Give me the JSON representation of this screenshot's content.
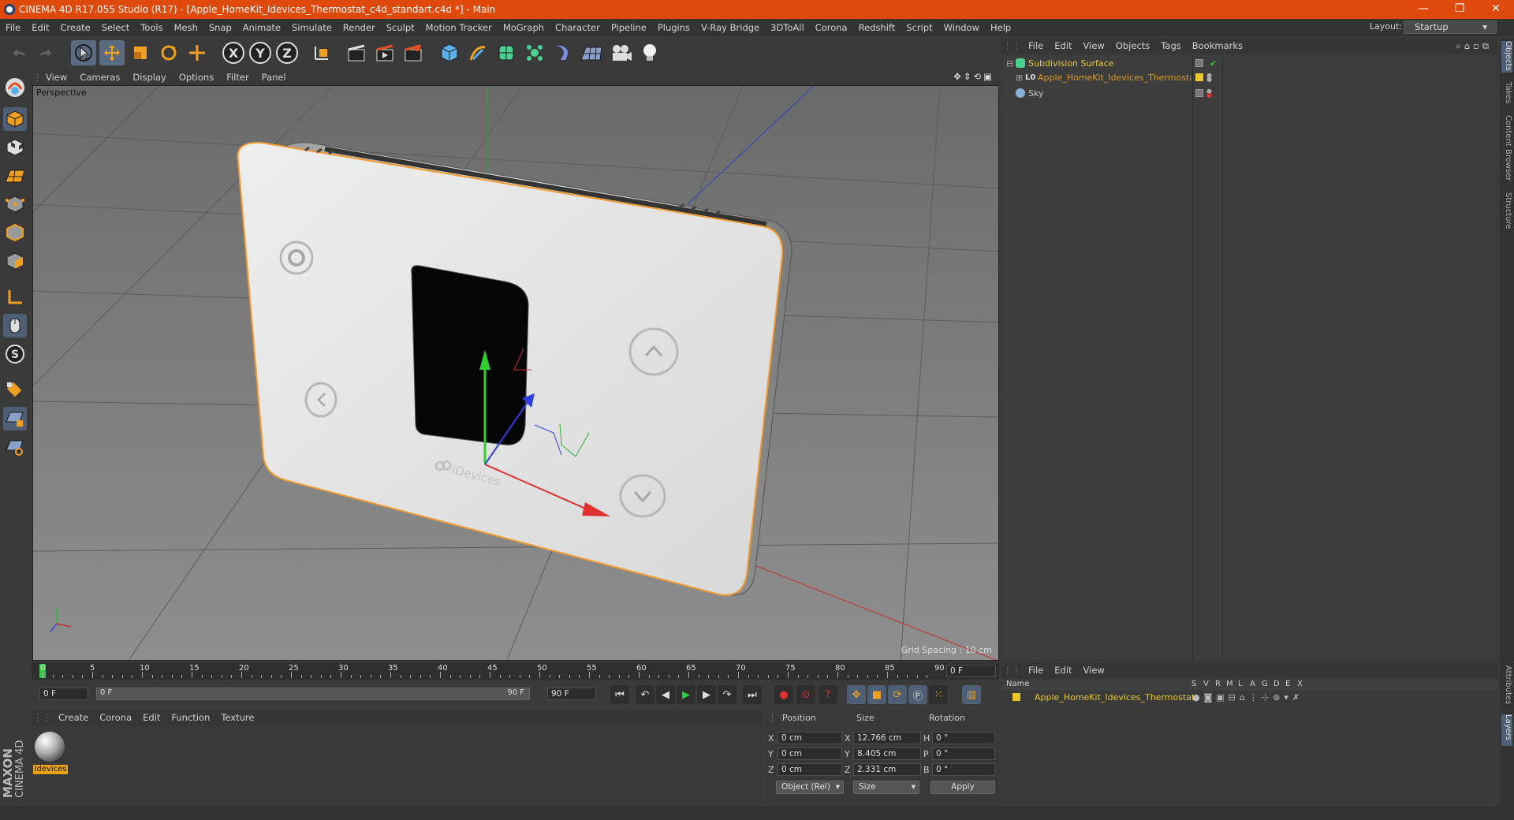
{
  "window": {
    "title": "CINEMA 4D R17.055 Studio (R17) - [Apple_HomeKit_Idevices_Thermostat_c4d_standart.c4d *] - Main",
    "minimize": "—",
    "restore": "❐",
    "close": "✕"
  },
  "menu": [
    "File",
    "Edit",
    "Create",
    "Select",
    "Tools",
    "Mesh",
    "Snap",
    "Animate",
    "Simulate",
    "Render",
    "Sculpt",
    "Motion Tracker",
    "MoGraph",
    "Character",
    "Pipeline",
    "Plugins",
    "V-Ray Bridge",
    "3DToAll",
    "Corona",
    "Redshift",
    "Script",
    "Window",
    "Help"
  ],
  "layout": {
    "label": "Layout:",
    "value": "Startup"
  },
  "axis_buttons": [
    "X",
    "Y",
    "Z"
  ],
  "viewport": {
    "menu": [
      "View",
      "Cameras",
      "Display",
      "Options",
      "Filter",
      "Panel"
    ],
    "camera_label": "Perspective",
    "grid_spacing": "Grid Spacing : 10 cm",
    "device_brand": "iDevices",
    "axis_colors": {
      "x": "#e03030",
      "y": "#30d030",
      "z": "#3040e0"
    }
  },
  "timeline": {
    "ticks": [
      "0",
      "5",
      "10",
      "15",
      "20",
      "25",
      "30",
      "35",
      "40",
      "45",
      "50",
      "55",
      "60",
      "65",
      "70",
      "75",
      "80",
      "85",
      "90"
    ],
    "current_frame_right": "0 F",
    "start_field": "0 F",
    "range_left": "0 F",
    "range_right": "90 F",
    "end_field": "90 F"
  },
  "material_manager": {
    "menu": [
      "Create",
      "Corona",
      "Edit",
      "Function",
      "Texture"
    ],
    "material_name": "Idevices"
  },
  "attributes": {
    "headers": [
      "Position",
      "Size",
      "Rotation"
    ],
    "rows": [
      {
        "axis": "X",
        "pos": "0 cm",
        "size_axis": "X",
        "size": "12.766 cm",
        "rot_axis": "H",
        "rot": "0 °"
      },
      {
        "axis": "Y",
        "pos": "0 cm",
        "size_axis": "Y",
        "size": "8.405 cm",
        "rot_axis": "P",
        "rot": "0 °"
      },
      {
        "axis": "Z",
        "pos": "0 cm",
        "size_axis": "Z",
        "size": "2.331 cm",
        "rot_axis": "B",
        "rot": "0 °"
      }
    ],
    "mode_select": "Object (Rel)",
    "size_select": "Size",
    "apply": "Apply"
  },
  "object_manager": {
    "menu": [
      "File",
      "Edit",
      "View",
      "Objects",
      "Tags",
      "Bookmarks"
    ],
    "objects": [
      {
        "name": "Subdivision Surface",
        "color": "#e8c840"
      },
      {
        "name": "Apple_HomeKit_Idevices_Thermostat",
        "color": "#d89a2a"
      },
      {
        "name": "Sky",
        "color": "#c8c8c8"
      }
    ]
  },
  "layer_manager": {
    "menu": [
      "File",
      "Edit",
      "View"
    ],
    "header_name": "Name",
    "header_cols": [
      "S",
      "V",
      "R",
      "M",
      "L",
      "A",
      "G",
      "D",
      "E",
      "X"
    ],
    "layers": [
      {
        "name": "Apple_HomeKit_Idevices_Thermostat",
        "color": "#e8c828"
      }
    ]
  },
  "right_tabs": [
    "Objects",
    "Takes",
    "Content Browser",
    "Structure",
    "Attributes",
    "Layers"
  ],
  "branding": {
    "vendor": "MAXON",
    "product": "CINEMA 4D"
  }
}
